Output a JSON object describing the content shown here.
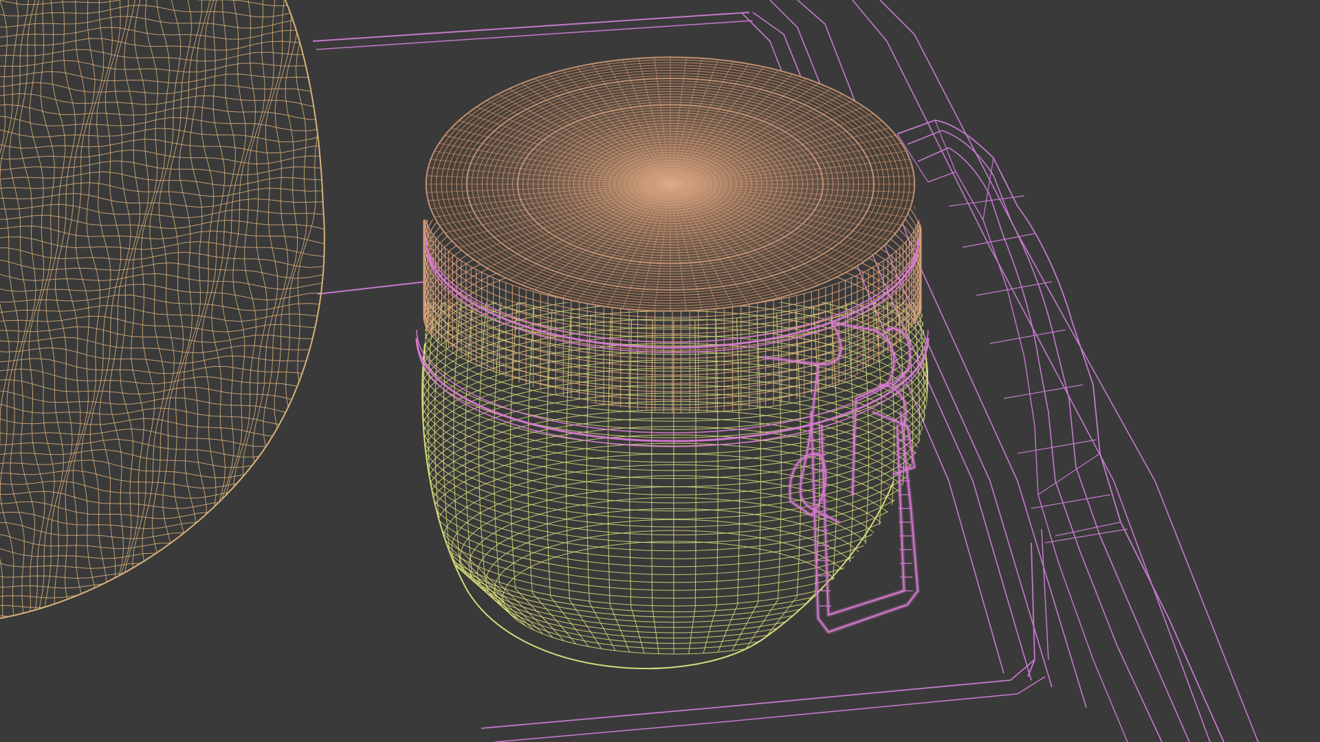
{
  "viewport": {
    "background_color": "#3a3a3a",
    "render_mode": "wireframe"
  },
  "objects": [
    {
      "name": "bread-loaf",
      "wire_color": "#d9b27a"
    },
    {
      "name": "jar-lid",
      "wire_color": "#d9a07a"
    },
    {
      "name": "jar-body",
      "wire_color": "#d7dc7a"
    },
    {
      "name": "jar-seal-ring",
      "wire_color": "#d77ad0"
    },
    {
      "name": "jar-clasp",
      "wire_color": "#d77ad0"
    },
    {
      "name": "tray",
      "wire_color": "#c77ad0"
    }
  ]
}
